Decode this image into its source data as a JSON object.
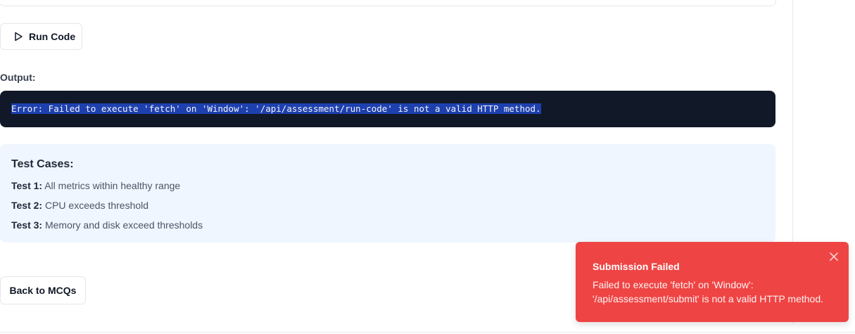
{
  "toolbar": {
    "run_label": "Run Code"
  },
  "output": {
    "label": "Output:",
    "text": "Error: Failed to execute 'fetch' on 'Window': '/api/assessment/run-code' is not a valid HTTP method."
  },
  "tests": {
    "title": "Test Cases:",
    "items": [
      {
        "label": "Test 1:",
        "description": "All metrics within healthy range"
      },
      {
        "label": "Test 2:",
        "description": "CPU exceeds threshold"
      },
      {
        "label": "Test 3:",
        "description": "Memory and disk exceed thresholds"
      }
    ]
  },
  "navigation": {
    "back_label": "Back to MCQs"
  },
  "toast": {
    "title": "Submission Failed",
    "message": "Failed to execute 'fetch' on 'Window': '/api/assessment/submit' is not a valid HTTP method.",
    "close_icon": "close-icon",
    "color": "#ef4444"
  },
  "icons": {
    "run": "play-icon"
  }
}
